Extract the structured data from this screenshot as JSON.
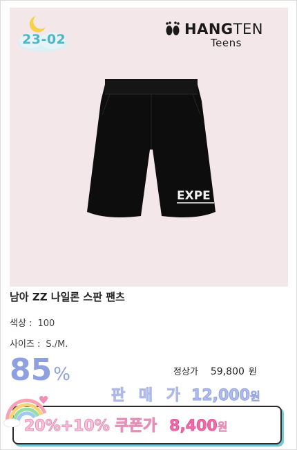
{
  "badge": {
    "code": "23-02"
  },
  "brand": {
    "name_bold": "HANG",
    "name_thin": "TEN",
    "sub": "Teens"
  },
  "product": {
    "print_text": "EXPE",
    "title": "남아 ZZ 나일론 스판 팬츠",
    "color_label": "색상 :",
    "color_value": "100",
    "size_label": "사이즈 :",
    "size_value": "S./M."
  },
  "pricing": {
    "discount_number": "85",
    "discount_symbol": "%",
    "regular_label": "정상가",
    "regular_price": "59,800",
    "regular_unit": "원",
    "sale_label": "판 매 가",
    "sale_price": "12,000",
    "sale_unit": "원",
    "coupon_label": "20%+10% 쿠폰가",
    "coupon_price": "8,400",
    "coupon_unit": "원"
  },
  "colors": {
    "image_background": "#f4e7ea",
    "discount": "#8ea0df",
    "badge_text": "#4fb6c8",
    "coupon_accent": "#f06aa8",
    "coupon_shadow": "#77c6d4"
  }
}
